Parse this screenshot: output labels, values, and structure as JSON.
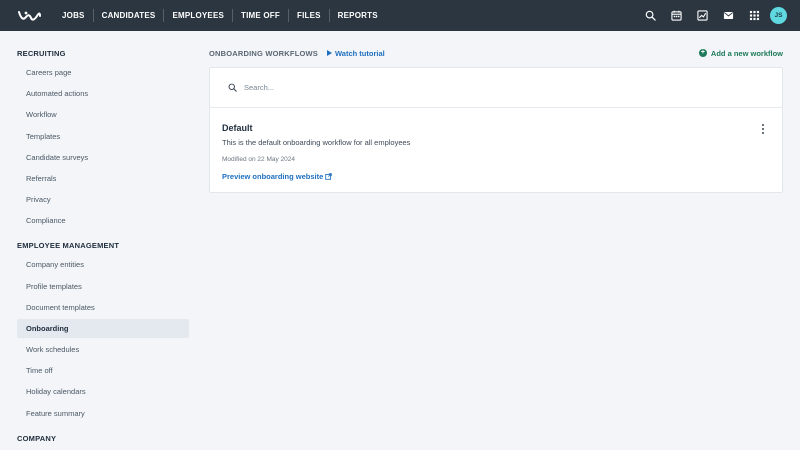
{
  "topbar": {
    "nav": [
      "JOBS",
      "CANDIDATES",
      "EMPLOYEES",
      "TIME OFF",
      "FILES",
      "REPORTS"
    ],
    "avatar_initials": "JS",
    "icons": [
      "search-icon",
      "calendar-icon",
      "chart-icon",
      "mail-icon",
      "apps-grid-icon"
    ]
  },
  "sidebar": {
    "sections": [
      {
        "heading": "RECRUITING",
        "items": [
          "Careers page",
          "Automated actions",
          "Workflow",
          "Templates",
          "Candidate surveys",
          "Referrals",
          "Privacy",
          "Compliance"
        ]
      },
      {
        "heading": "EMPLOYEE MANAGEMENT",
        "items": [
          "Company entities",
          "Profile templates",
          "Document templates",
          "Onboarding",
          "Work schedules",
          "Time off",
          "Holiday calendars",
          "Feature summary"
        ]
      },
      {
        "heading": "COMPANY",
        "items": []
      }
    ],
    "active_item": "Onboarding"
  },
  "main": {
    "title": "ONBOARDING WORKFLOWS",
    "watch_label": "Watch tutorial",
    "add_label": "Add a new workflow",
    "search_placeholder": "Search...",
    "workflow": {
      "name": "Default",
      "description": "This is the default onboarding workflow for all employees",
      "modified": "Modified on 22 May 2024",
      "link_label": "Preview onboarding website"
    }
  },
  "colors": {
    "topbar": "#2b3640",
    "link_blue": "#1f6fbf",
    "add_green": "#1e7a5a",
    "avatar": "#5fd8e0"
  }
}
